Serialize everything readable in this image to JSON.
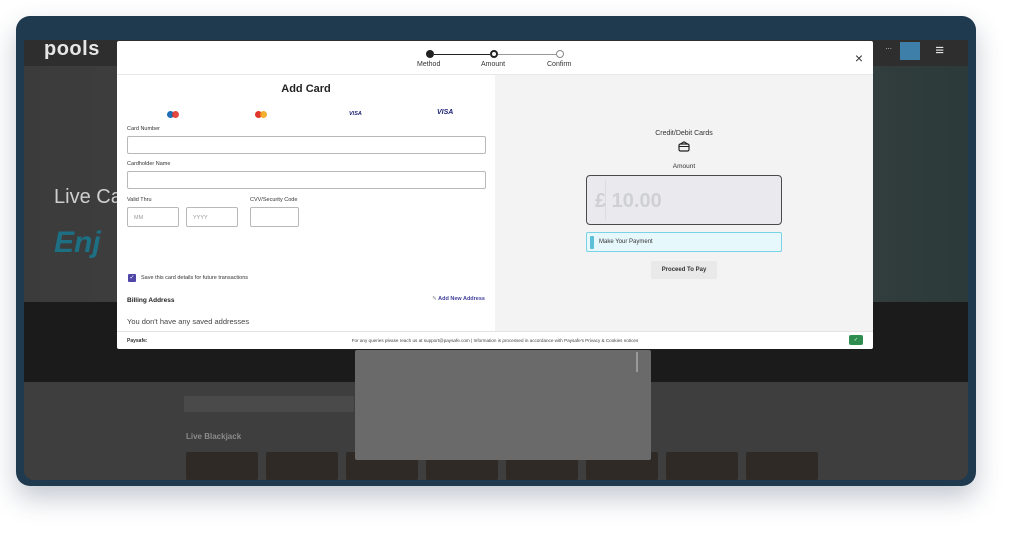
{
  "site": {
    "logo": "pools",
    "hero_line1": "Live Ca",
    "hero_line2": "Enj",
    "section_label": "Live Blackjack"
  },
  "stepper": {
    "steps": [
      "Method",
      "Amount",
      "Confirm"
    ]
  },
  "close_symbol": "×",
  "form": {
    "title": "Add Card",
    "card_brands": [
      "",
      "",
      "VISA",
      "VISA"
    ],
    "card_number_label": "Card Number",
    "cardholder_label": "Cardholder Name",
    "valid_thru_label": "Valid Thru",
    "month_placeholder": "MM",
    "year_placeholder": "YYYY",
    "cvv_label": "CVV/Security Code",
    "save_card_label": "Save this card details for future transactions",
    "billing_label": "Billing Address",
    "add_address_label": "Add New Address",
    "no_address_text": "You don't have any saved addresses"
  },
  "payment": {
    "method_title": "Credit/Debit Cards",
    "amount_label": "Amount",
    "amount_value": "£ 10.00",
    "make_payment_label": "Make Your Payment",
    "proceed_label": "Proceed To Pay"
  },
  "footer": {
    "brand": "Paysafe:",
    "support_text": "For any queries please reach us at support@paysafe.com   |   Information is processed in accordance with Paysafe's Privacy & Cookies notices"
  },
  "colors": {
    "frame": "#1f3a4e",
    "accent": "#4f46a8",
    "pay_bar": "#78d3e6"
  }
}
